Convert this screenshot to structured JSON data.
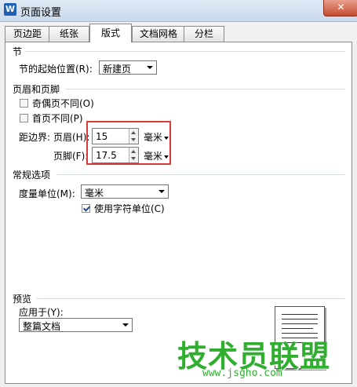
{
  "window": {
    "title": "页面设置",
    "app_icon": "W",
    "close_label": "✕"
  },
  "tabs": [
    {
      "label": "页边距",
      "active": false
    },
    {
      "label": "纸张",
      "active": false
    },
    {
      "label": "版式",
      "active": true
    },
    {
      "label": "文档网格",
      "active": false
    },
    {
      "label": "分栏",
      "active": false
    }
  ],
  "section": {
    "group_label": "节",
    "start_label": "节的起始位置(R):",
    "start_value": "新建页"
  },
  "header_footer": {
    "group_label": "页眉和页脚",
    "odd_even_label": "奇偶页不同(O)",
    "odd_even_checked": false,
    "first_page_label": "首页不同(P)",
    "first_page_checked": false,
    "margin_label": "距边界:",
    "header_label": "页眉(H):",
    "header_value": "15",
    "header_unit": "毫米",
    "footer_label": "页脚(F):",
    "footer_value": "17.5",
    "footer_unit": "毫米"
  },
  "general": {
    "group_label": "常规选项",
    "unit_label": "度量单位(M):",
    "unit_value": "毫米",
    "char_unit_label": "使用字符单位(C)",
    "char_unit_checked": true
  },
  "preview": {
    "group_label": "预览",
    "apply_label": "应用于(Y):",
    "apply_value": "整篇文档"
  },
  "watermark": {
    "text": "技术员联盟",
    "url": "www.jsgho.com"
  },
  "colors": {
    "highlight": "#d93a3a",
    "watermark": "#2fae2f"
  }
}
